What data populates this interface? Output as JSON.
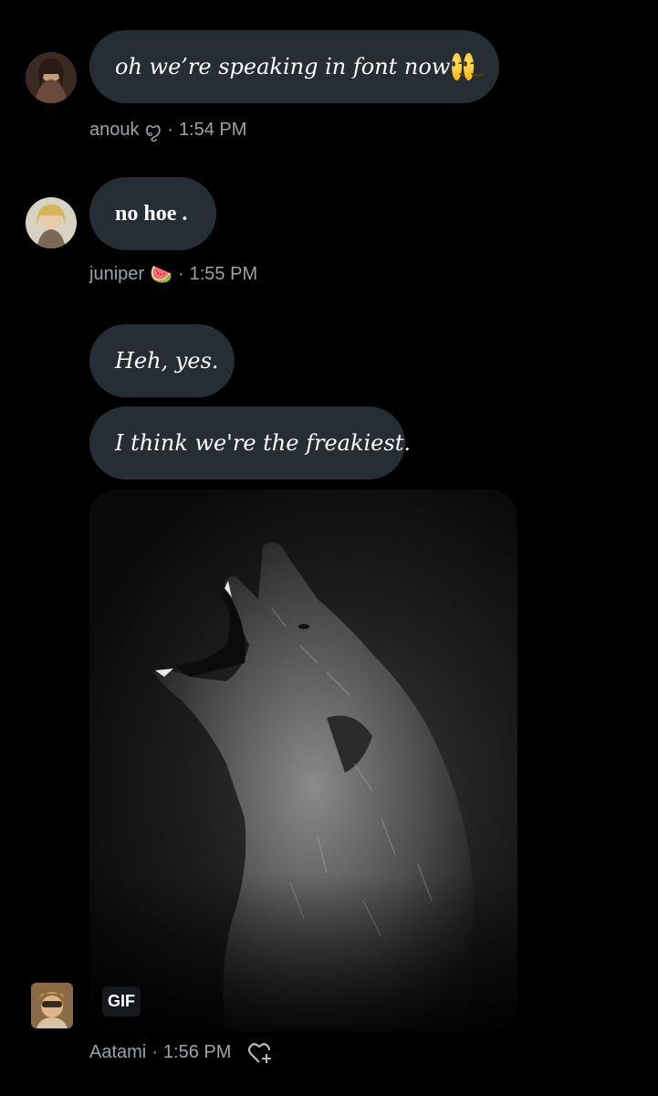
{
  "messages": [
    {
      "text": "oh we’re speaking in font now",
      "emoji": [
        "wink-emoji",
        "wink-emoji"
      ],
      "author": "anouk",
      "author_suffix": "ꨄ",
      "time": "1:54 PM"
    },
    {
      "text": "no hoe .",
      "author": "juniper",
      "author_suffix": "🍉",
      "time": "1:55 PM"
    },
    {
      "texts": [
        "Heh, yes.",
        "I think we're the freakiest."
      ],
      "media_label": "GIF",
      "author": "Aatami",
      "time": "1:56 PM"
    }
  ],
  "separator": "·",
  "colors": {
    "background": "#000000",
    "bubble": "#252d35",
    "meta_text": "#9aa3ab"
  },
  "icons": {
    "react": "heart-plus-icon",
    "media": "howling-wolf-gif"
  }
}
